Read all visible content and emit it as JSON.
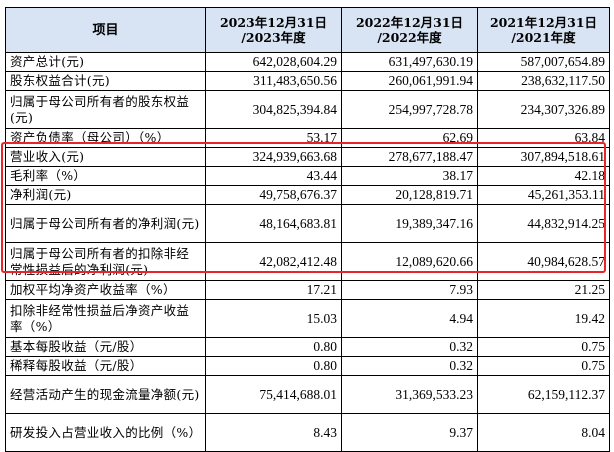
{
  "header": {
    "item": "项目",
    "col1_line1": "2023年12月31日",
    "col1_line2": "/2023年度",
    "col2_line1": "2022年12月31日",
    "col2_line2": "/2022年度",
    "col3_line1": "2021年12月31日",
    "col3_line2": "/2021年度"
  },
  "rows": [
    {
      "label": "资产总计(元)",
      "v2023": "642,028,604.29",
      "v2022": "631,497,630.19",
      "v2021": "587,007,654.89"
    },
    {
      "label": "股东权益合计(元)",
      "v2023": "311,483,650.56",
      "v2022": "260,061,991.94",
      "v2021": "238,632,117.50"
    },
    {
      "label": "归属于母公司所有者的股东权益(元)",
      "v2023": "304,825,394.84",
      "v2022": "254,997,728.78",
      "v2021": "234,307,326.89"
    },
    {
      "label": "资产负债率（母公司）（%）",
      "v2023": "53.17",
      "v2022": "62.69",
      "v2021": "63.84"
    },
    {
      "label": "营业收入(元)",
      "v2023": "324,939,663.68",
      "v2022": "278,677,188.47",
      "v2021": "307,894,518.61"
    },
    {
      "label": "毛利率（%）",
      "v2023": "43.44",
      "v2022": "38.17",
      "v2021": "42.18"
    },
    {
      "label": "净利润(元)",
      "v2023": "49,758,676.37",
      "v2022": "20,128,819.71",
      "v2021": "45,261,353.11"
    },
    {
      "label": "归属于母公司所有者的净利润(元)",
      "v2023": "48,164,683.81",
      "v2022": "19,389,347.16",
      "v2021": "44,832,914.25"
    },
    {
      "label": "归属于母公司所有者的扣除非经常性损益后的净利润(元)",
      "v2023": "42,082,412.48",
      "v2022": "12,089,620.66",
      "v2021": "40,984,628.57"
    },
    {
      "label": "加权平均净资产收益率（%）",
      "v2023": "17.21",
      "v2022": "7.93",
      "v2021": "21.25"
    },
    {
      "label": "扣除非经常性损益后净资产收益率（%）",
      "v2023": "15.03",
      "v2022": "4.94",
      "v2021": "19.42"
    },
    {
      "label": "基本每股收益（元/股）",
      "v2023": "0.80",
      "v2022": "0.32",
      "v2021": "0.75"
    },
    {
      "label": "稀释每股收益（元/股）",
      "v2023": "0.80",
      "v2022": "0.32",
      "v2021": "0.75"
    },
    {
      "label": "经营活动产生的现金流量净额(元)",
      "v2023": "75,414,688.01",
      "v2022": "31,369,533.23",
      "v2021": "62,159,112.37"
    },
    {
      "label": "研发投入占营业收入的比例（%）",
      "v2023": "8.43",
      "v2022": "9.37",
      "v2021": "8.04"
    }
  ],
  "highlight_color": "#e8262a",
  "header_color": "#d8e3f3"
}
